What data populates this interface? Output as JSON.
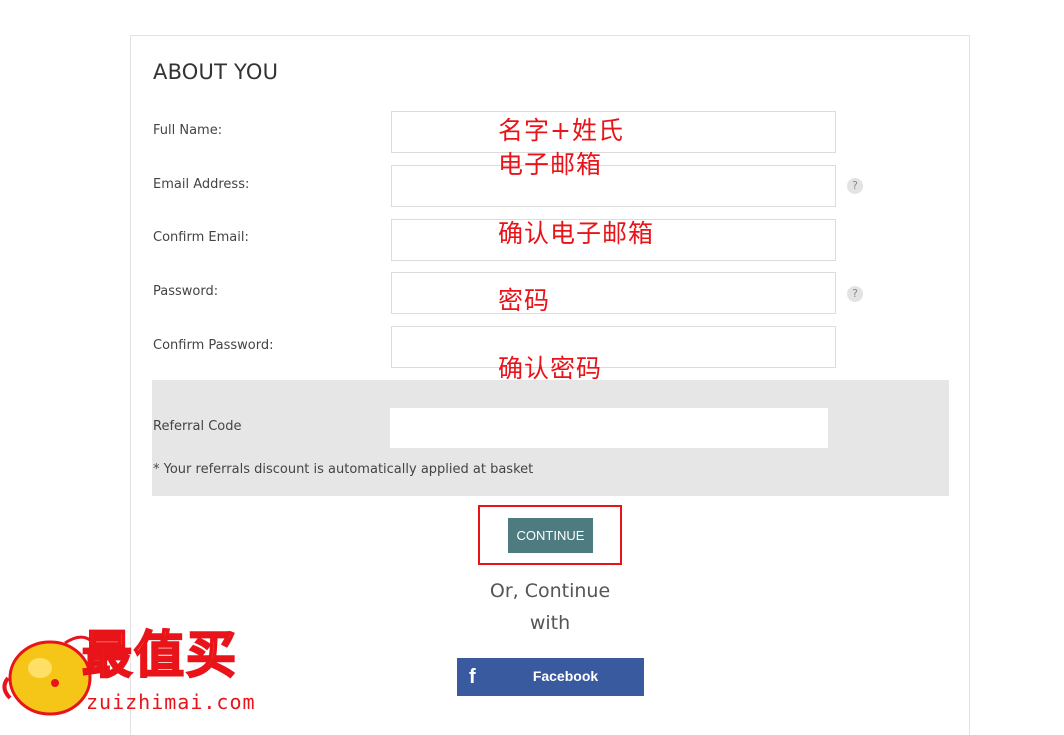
{
  "form": {
    "title": "ABOUT YOU",
    "fields": {
      "full_name": {
        "label": "Full Name:",
        "value": "",
        "annotation": "名字+姓氏"
      },
      "email": {
        "label": "Email Address:",
        "value": "",
        "annotation": "电子邮箱",
        "help": "?"
      },
      "confirm_email": {
        "label": "Confirm Email:",
        "value": "",
        "annotation": "确认电子邮箱"
      },
      "password": {
        "label": "Password:",
        "value": "",
        "annotation": "密码",
        "help": "?"
      },
      "confirm_password": {
        "label": "Confirm Password:",
        "value": "",
        "annotation": "确认密码"
      }
    },
    "referral": {
      "label": "Referral Code",
      "value": "",
      "note": "* Your referrals discount is automatically applied at basket"
    },
    "continue_label": "CONTINUE",
    "or_line1": "Or, Continue",
    "or_line2": "with",
    "facebook": {
      "icon": "f",
      "label": "Facebook"
    }
  },
  "watermark": {
    "logo_text": "最值买",
    "domain": "zuizhimai.com"
  },
  "colors": {
    "accent": "#4d7b7f",
    "annotation": "#e8141a",
    "facebook": "#3a5aa0",
    "panel": "#e6e6e6"
  }
}
